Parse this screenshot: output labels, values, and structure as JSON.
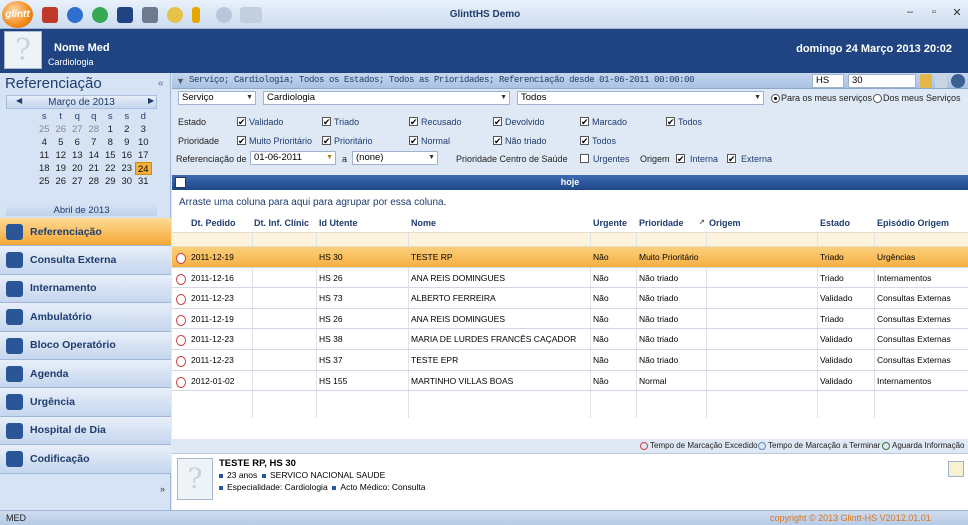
{
  "window": {
    "title": "GlinttHS Demo",
    "logo": "glintt"
  },
  "header": {
    "user_name": "Nome Med",
    "user_specialty": "Cardiologia",
    "datetime": "domingo 24 Março 2013 20:02"
  },
  "left_panel": {
    "title": "Referenciação",
    "calendar": {
      "month": "Março de 2013",
      "dow": [
        "s",
        "t",
        "q",
        "q",
        "s",
        "s",
        "d"
      ],
      "weeks": [
        [
          "25",
          "26",
          "27",
          "28",
          "1",
          "2",
          "3"
        ],
        [
          "4",
          "5",
          "6",
          "7",
          "8",
          "9",
          "10"
        ],
        [
          "11",
          "12",
          "13",
          "14",
          "15",
          "16",
          "17"
        ],
        [
          "18",
          "19",
          "20",
          "21",
          "22",
          "23",
          "24"
        ],
        [
          "25",
          "26",
          "27",
          "28",
          "29",
          "30",
          "31"
        ]
      ],
      "next_month": "Abril de 2013"
    },
    "nav": [
      {
        "label": "Referenciação",
        "icon": "referral-icon",
        "selected": true
      },
      {
        "label": "Consulta Externa",
        "icon": "stethoscope-icon"
      },
      {
        "label": "Internamento",
        "icon": "bed-icon"
      },
      {
        "label": "Ambulatório",
        "icon": "ambulatory-icon"
      },
      {
        "label": "Bloco Operatório",
        "icon": "surgeon-icon"
      },
      {
        "label": "Agenda",
        "icon": "calendar-icon"
      },
      {
        "label": "Urgência",
        "icon": "emergency-cross-icon"
      },
      {
        "label": "Hospital de Dia",
        "icon": "hospital-icon"
      },
      {
        "label": "Codificação",
        "icon": "coding-icon"
      }
    ]
  },
  "filter_summary": "Serviço; Cardiologia; Todos os Estados; Todos as Prioridades; Referenciação desde 01-06-2011 00:00:00",
  "search": {
    "type": "HS",
    "value": "30"
  },
  "filters": {
    "servico_select": "Serviço",
    "servico_value": "Cardiologia",
    "estado_select": "Todos",
    "scope_options": [
      "Para os meus serviços",
      "Dos meus Serviços"
    ],
    "estado_label": "Estado",
    "estados": [
      "Validado",
      "Triado",
      "Recusado",
      "Devolvido",
      "Marcado",
      "Todos"
    ],
    "prioridade_label": "Prioridade",
    "prioridades": [
      "Muito Prioritário",
      "Prioritário",
      "Normal",
      "Não triado",
      "Todos"
    ],
    "ref_de_label": "Referenciação de",
    "ref_de_value": "01-06-2011",
    "ref_a_label": "a",
    "ref_a_value": "(none)",
    "prioridade_cs_label": "Prioridade Centro de Saúde",
    "urgentes_label": "Urgentes",
    "origem_label": "Origem",
    "interna_label": "Interna",
    "externa_label": "Externa"
  },
  "grid": {
    "title": "hoje",
    "group_hint": "Arraste uma coluna para aqui para agrupar por essa coluna.",
    "columns": [
      "Dt. Pedido",
      "Dt. Inf. Clínic",
      "Id Utente",
      "Nome",
      "Urgente",
      "Prioridade",
      "Origem",
      "Estado",
      "Episódio Origem"
    ],
    "rows": [
      [
        "2011-12-19",
        "",
        "HS 30",
        "TESTE RP",
        "Não",
        "Muito Prioritário",
        "",
        "Triado",
        "Urgências"
      ],
      [
        "2011-12-16",
        "",
        "HS 26",
        "ANA REIS DOMINGUES",
        "Não",
        "Não triado",
        "",
        "Triado",
        "Internamentos"
      ],
      [
        "2011-12-23",
        "",
        "HS 73",
        "ALBERTO FERREIRA",
        "Não",
        "Não triado",
        "",
        "Validado",
        "Consultas Externas"
      ],
      [
        "2011-12-19",
        "",
        "HS 26",
        "ANA REIS DOMINGUES",
        "Não",
        "Não triado",
        "",
        "Triado",
        "Consultas Externas"
      ],
      [
        "2011-12-23",
        "",
        "HS 38",
        "MARIA DE LURDES FRANCÊS CAÇADOR",
        "Não",
        "Não triado",
        "",
        "Validado",
        "Consultas Externas"
      ],
      [
        "2011-12-23",
        "",
        "HS 37",
        "TESTE EPR",
        "Não",
        "Não triado",
        "",
        "Validado",
        "Consultas Externas"
      ],
      [
        "2012-01-02",
        "",
        "HS 155",
        "MARTINHO VILLAS BOAS",
        "Não",
        "Normal",
        "",
        "Validado",
        "Internamentos"
      ]
    ]
  },
  "legend": [
    "Tempo de Marcação Excedido",
    "Tempo de Marcação a Terminar",
    "Aguarda Informação"
  ],
  "detail": {
    "name": "TESTE RP, HS 30",
    "age": "23 anos",
    "insurer": "SERVICO NACIONAL SAUDE",
    "specialty_label": "Especialidade:",
    "specialty": "Cardiologia",
    "act_label": "Acto Médico:",
    "act": "Consulta"
  },
  "status": {
    "left": "MED",
    "right": "copyright © 2013 Glintt-HS       V2012.01.01"
  }
}
